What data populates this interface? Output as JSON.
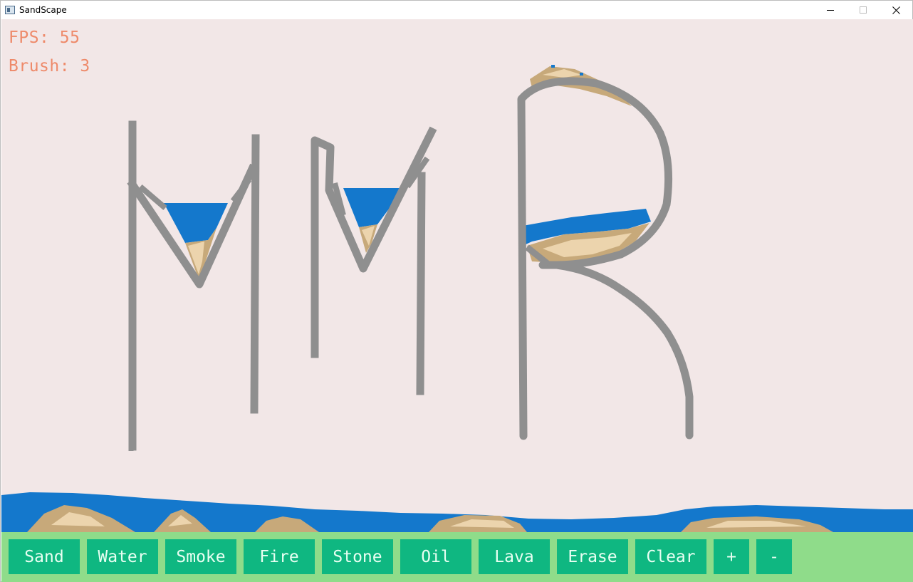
{
  "window": {
    "title": "SandScape",
    "controls": [
      "minimize-icon",
      "maximize-icon",
      "close-icon"
    ]
  },
  "hud": {
    "fps": "FPS: 55",
    "brush": "Brush: 3"
  },
  "colors": {
    "background": "#f2e7e7",
    "stone": "#8f8f8f",
    "water": "#1478cc",
    "sand": "#c7a97a",
    "sand_light": "#ecd4ad",
    "toolbar": "#8fdc8a",
    "button": "#0fb781",
    "button_text": "#e8fff2",
    "hud_text": "#ee8a6a"
  },
  "toolbar": {
    "buttons": [
      {
        "label": "Sand"
      },
      {
        "label": "Water"
      },
      {
        "label": "Smoke"
      },
      {
        "label": "Fire"
      },
      {
        "label": "Stone"
      },
      {
        "label": "Oil"
      },
      {
        "label": "Lava"
      },
      {
        "label": "Erase"
      },
      {
        "label": "Clear"
      },
      {
        "label": "+"
      },
      {
        "label": "-"
      }
    ]
  }
}
